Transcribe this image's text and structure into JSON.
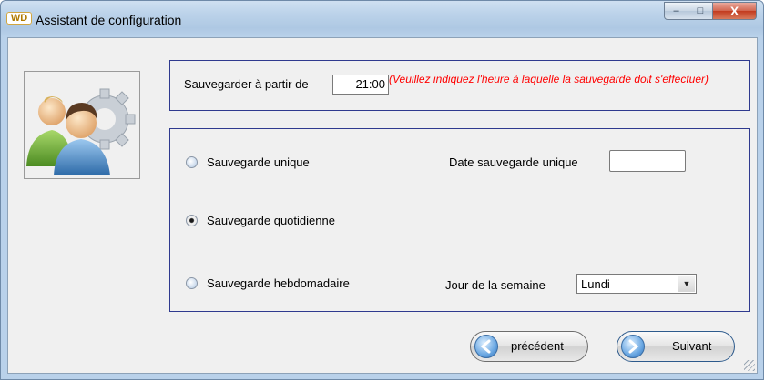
{
  "window": {
    "title": "Assistant de configuration",
    "app_icon_text": "WD",
    "controls": {
      "minimize": "–",
      "maximize": "□",
      "close": "X"
    }
  },
  "schedule": {
    "start_label": "Sauvegarder à partir de",
    "start_time": "21:00",
    "hint": "(Veuillez indiquez l'heure à laquelle la sauvegarde doit s'effectuer)"
  },
  "options": {
    "unique_label": "Sauvegarde unique",
    "unique_date_label": "Date sauvegarde unique",
    "unique_date_value": "",
    "daily_label": "Sauvegarde quotidienne",
    "weekly_label": "Sauvegarde hebdomadaire",
    "weekday_label": "Jour de la semaine",
    "weekday_value": "Lundi",
    "selected": "daily"
  },
  "buttons": {
    "previous": "précédent",
    "next": "Suivant"
  },
  "icons": {
    "users": "users-gear-icon",
    "dropdown": "chevron-down-icon",
    "back_arrow": "arrow-left-icon",
    "forward_arrow": "arrow-right-icon"
  },
  "colors": {
    "hint": "#ff0000",
    "panel_border": "#2f3a8f",
    "title_bar": "#bcd3ea"
  }
}
